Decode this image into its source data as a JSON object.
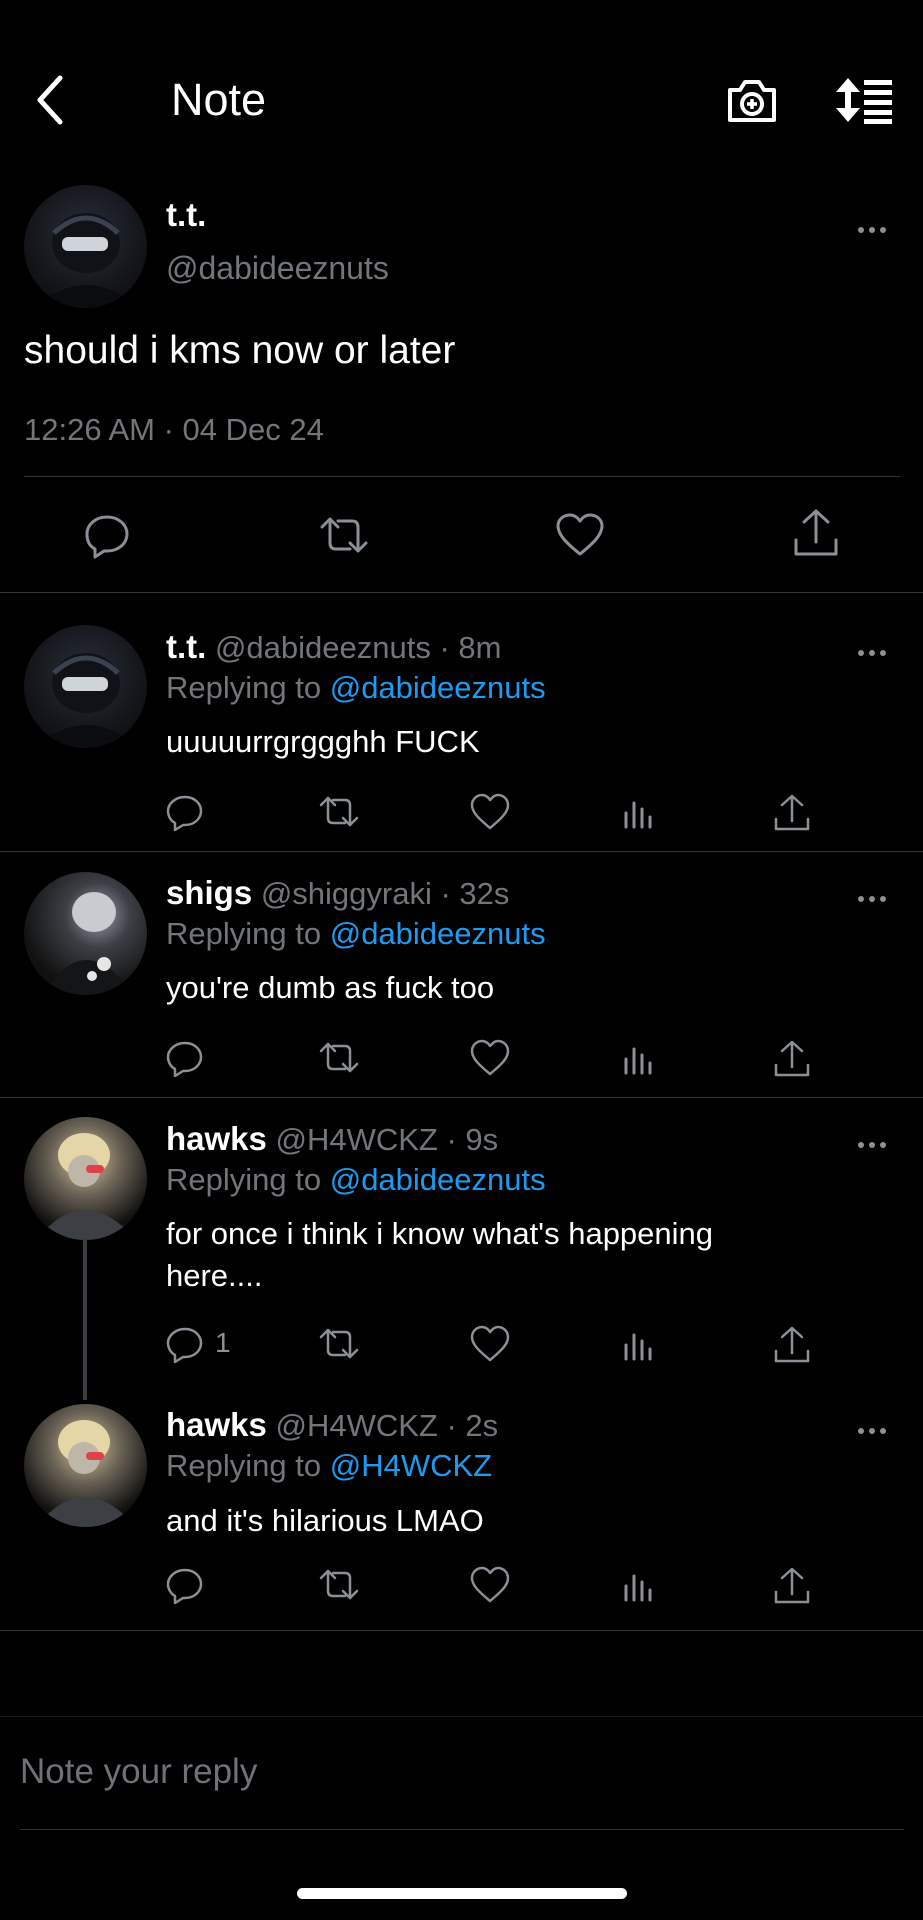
{
  "header": {
    "title": "Note"
  },
  "main_tweet": {
    "name": "t.t.",
    "handle": "@dabideeznuts",
    "text": "should i kms now or later",
    "timestamp": "12:26 AM · 04 Dec 24"
  },
  "replies": [
    {
      "name": "t.t.",
      "handle": "@dabideeznuts",
      "time": "· 8m",
      "replying_prefix": "Replying to",
      "replying_to": "@dabideeznuts",
      "text": "uuuuurrgrggghh FUCK",
      "reply_count": ""
    },
    {
      "name": "shigs",
      "handle": "@shiggyraki",
      "time": "· 32s",
      "replying_prefix": "Replying to",
      "replying_to": "@dabideeznuts",
      "text": "you're dumb as fuck too",
      "reply_count": ""
    },
    {
      "name": "hawks",
      "handle": "@H4WCKZ",
      "time": "· 9s",
      "replying_prefix": "Replying to",
      "replying_to": "@dabideeznuts",
      "text_line1": "for once i think i know what's happening",
      "text_line2": "here....",
      "reply_count": "1"
    },
    {
      "name": "hawks",
      "handle": "@H4WCKZ",
      "time": "· 2s",
      "replying_prefix": "Replying to",
      "replying_to": "@H4WCKZ",
      "text": "and it's hilarious LMAO",
      "reply_count": ""
    }
  ],
  "compose": {
    "placeholder": "Note your reply"
  },
  "icons": [
    "back-icon",
    "camera-icon",
    "sort-icon",
    "reply-icon",
    "retweet-icon",
    "like-icon",
    "views-icon",
    "share-icon",
    "more-icon"
  ],
  "colors": {
    "background": "#000000",
    "link": "#1d9bf0",
    "muted": "#72767b"
  }
}
